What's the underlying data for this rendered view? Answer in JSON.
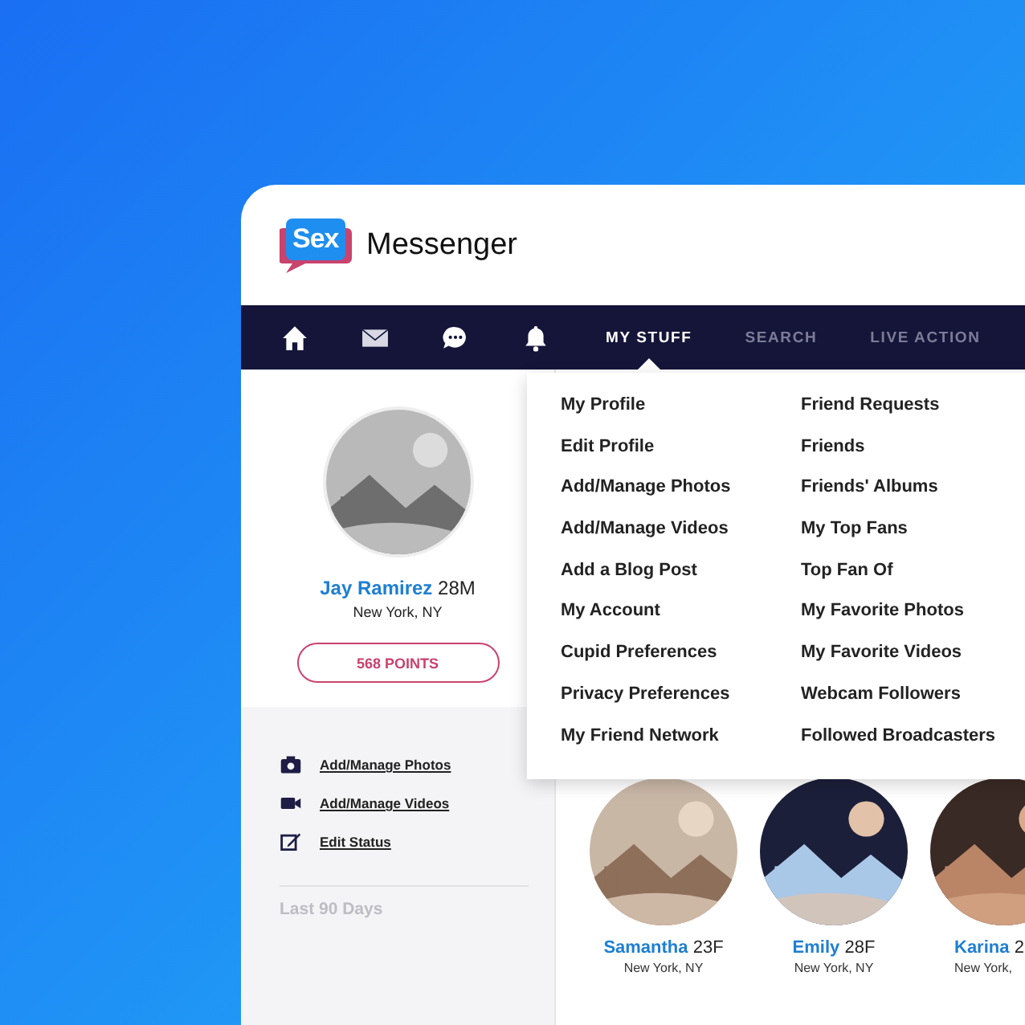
{
  "logo": {
    "badge": "Sex",
    "name": "Messenger"
  },
  "nav": {
    "tabs": [
      {
        "label": "MY STUFF",
        "selected": true
      },
      {
        "label": "SEARCH",
        "selected": false
      },
      {
        "label": "LIVE ACTION",
        "selected": false
      }
    ]
  },
  "profile": {
    "name": "Jay Ramirez",
    "age": "28M",
    "location": "New York, NY",
    "points": "568 POINTS"
  },
  "quick_links": [
    "Add/Manage Photos",
    "Add/Manage Videos",
    "Edit Status"
  ],
  "stats_heading": "Last 90 Days",
  "dropdown": {
    "columns": [
      [
        "My Profile",
        "Edit Profile",
        "Add/Manage Photos",
        "Add/Manage Videos",
        "Add a Blog Post",
        "My Account",
        "Cupid Preferences",
        "Privacy Preferences",
        "My Friend Network"
      ],
      [
        "Friend Requests",
        "Friends",
        "Friends' Albums",
        "My Top Fans",
        "Top Fan Of",
        "My Favorite Photos",
        "My Favorite Videos",
        "Webcam Followers",
        "Followed Broadcasters"
      ]
    ]
  },
  "members": [
    {
      "name": "Samantha",
      "age": "23F",
      "location": "New York, NY"
    },
    {
      "name": "Emily",
      "age": "28F",
      "location": "New York, NY"
    },
    {
      "name": "Karina",
      "age": "2",
      "location": "New York,"
    }
  ]
}
